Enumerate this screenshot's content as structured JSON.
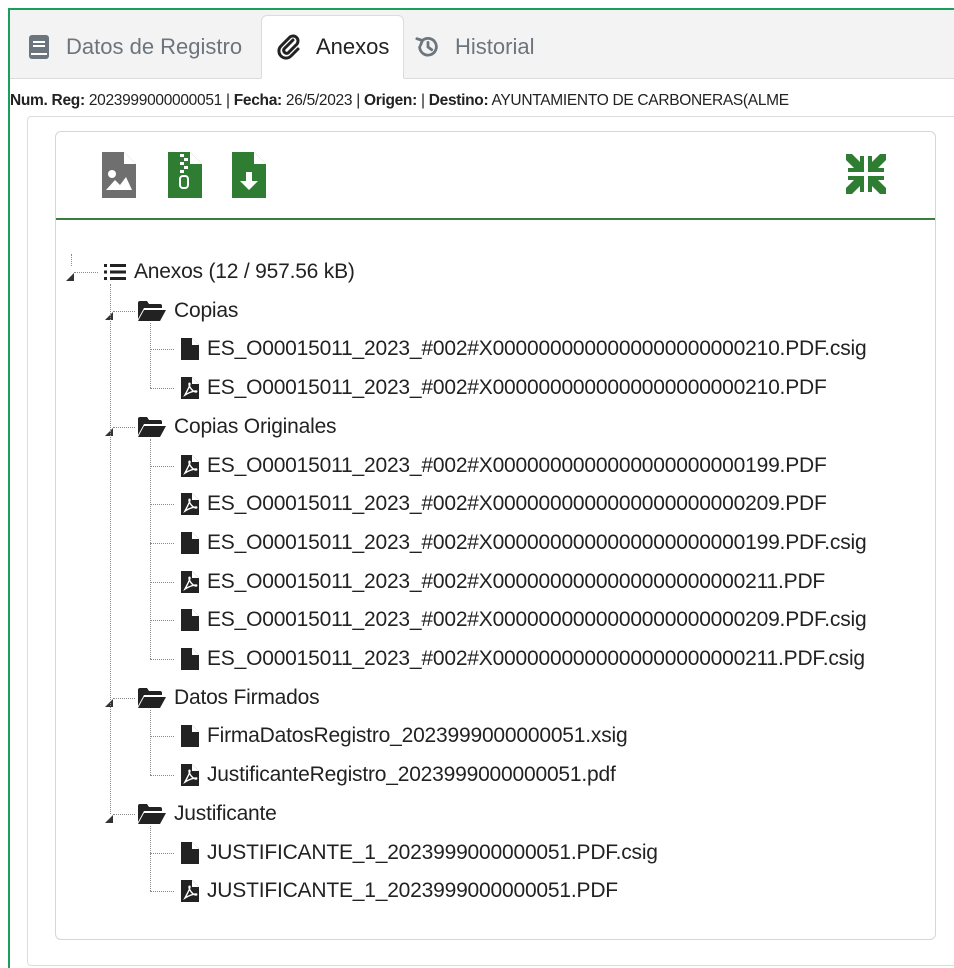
{
  "tabs": [
    {
      "label": "Datos de Registro",
      "icon": "book-icon",
      "active": false
    },
    {
      "label": "Anexos",
      "icon": "paperclip-icon",
      "active": true
    },
    {
      "label": "Historial",
      "icon": "history-icon",
      "active": false
    }
  ],
  "registro": {
    "num_label": "Num. Reg:",
    "num_value": "2023999000000051",
    "fecha_label": "Fecha:",
    "fecha_value": "26/5/2023",
    "origen_label": "Origen:",
    "origen_value": "",
    "destino_label": "Destino:",
    "destino_value": "AYUNTAMIENTO DE CARBONERAS(ALME",
    "separator": "|"
  },
  "toolbar": {
    "buttons": [
      {
        "icon": "file-image-icon",
        "color": "#6f6f6f"
      },
      {
        "icon": "file-zip-icon",
        "color": "#2e7d32"
      },
      {
        "icon": "file-download-icon",
        "color": "#2e7d32"
      }
    ],
    "collapse_icon": "compress-icon",
    "accent": "#2e7d32"
  },
  "tree": {
    "root": {
      "label": "Anexos (12 / 957.56 kB)",
      "icon": "list-icon"
    },
    "folders": [
      {
        "label": "Copias",
        "icon": "folder-open-icon",
        "files": [
          {
            "name": "ES_O00015011_2023_#002#X0000000000000000000000210.PDF.csig",
            "icon": "file-icon"
          },
          {
            "name": "ES_O00015011_2023_#002#X0000000000000000000000210.PDF",
            "icon": "file-pdf-icon"
          }
        ]
      },
      {
        "label": "Copias Originales",
        "icon": "folder-open-icon",
        "files": [
          {
            "name": "ES_O00015011_2023_#002#X0000000000000000000000199.PDF",
            "icon": "file-pdf-icon"
          },
          {
            "name": "ES_O00015011_2023_#002#X0000000000000000000000209.PDF",
            "icon": "file-pdf-icon"
          },
          {
            "name": "ES_O00015011_2023_#002#X0000000000000000000000199.PDF.csig",
            "icon": "file-icon"
          },
          {
            "name": "ES_O00015011_2023_#002#X0000000000000000000000211.PDF",
            "icon": "file-pdf-icon"
          },
          {
            "name": "ES_O00015011_2023_#002#X0000000000000000000000209.PDF.csig",
            "icon": "file-icon"
          },
          {
            "name": "ES_O00015011_2023_#002#X0000000000000000000000211.PDF.csig",
            "icon": "file-icon"
          }
        ]
      },
      {
        "label": "Datos Firmados",
        "icon": "folder-open-icon",
        "files": [
          {
            "name": "FirmaDatosRegistro_2023999000000051.xsig",
            "icon": "file-icon"
          },
          {
            "name": "JustificanteRegistro_2023999000000051.pdf",
            "icon": "file-pdf-icon"
          }
        ]
      },
      {
        "label": "Justificante",
        "icon": "folder-open-icon",
        "files": [
          {
            "name": "JUSTIFICANTE_1_2023999000000051.PDF.csig",
            "icon": "file-icon"
          },
          {
            "name": "JUSTIFICANTE_1_2023999000000051.PDF",
            "icon": "file-pdf-icon"
          }
        ]
      }
    ]
  },
  "colors": {
    "frame": "#18a05a",
    "accent": "#2e7d32",
    "muted": "#6c757d"
  }
}
